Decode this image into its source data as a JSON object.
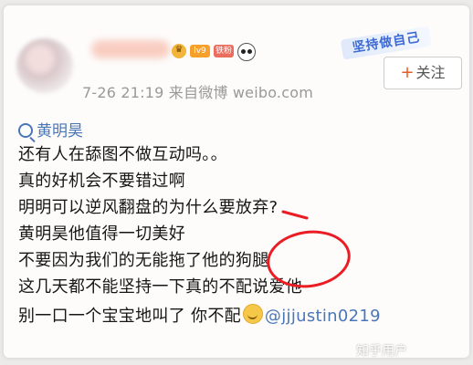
{
  "post": {
    "badges": {
      "level": "lv9",
      "fan": "铁粉"
    },
    "time_source": "7-26 21:19  来自微博 weibo.com",
    "event_banner": "坚持做自己",
    "follow_plus": "+",
    "follow_label": "关注",
    "topic": "黄明昊",
    "lines": [
      "还有人在舔图不做互动吗。。",
      "真的好机会不要错过啊",
      "明明可以逆风翻盘的为什么要放弃?",
      "黄明昊他值得一切美好",
      "不要因为我们的无能拖了他的狗腿",
      "这几天都不能坚持一下真的不配说爱他"
    ],
    "last_line": "别一口一个宝宝地叫了 你不配",
    "mention": "@jjjustin0219"
  },
  "annotation": {
    "circle_color": "#ea1c24"
  },
  "watermark": "知乎用户",
  "colors": {
    "link": "#4a76b8",
    "follow_plus": "#e45b24",
    "text": "#161616",
    "meta": "#999999"
  }
}
